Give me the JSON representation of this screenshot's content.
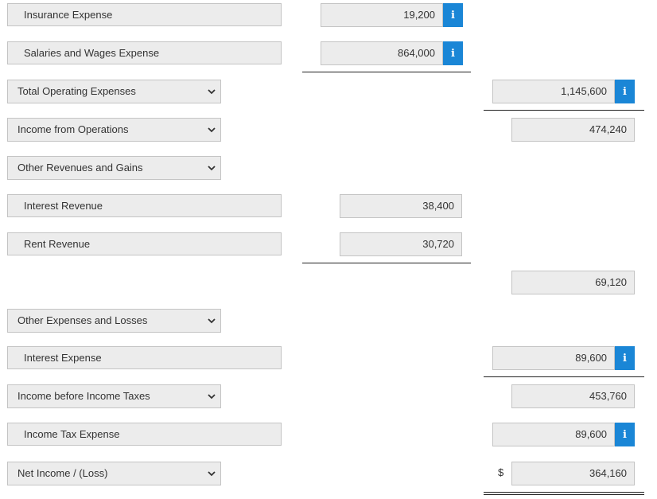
{
  "rows": {
    "insurance_expense": {
      "label": "Insurance Expense",
      "value": "19,200"
    },
    "salaries_wages_expense": {
      "label": "Salaries and Wages Expense",
      "value": "864,000"
    },
    "total_operating_expenses": {
      "label": "Total Operating Expenses",
      "value": "1,145,600"
    },
    "income_from_operations": {
      "label": "Income from Operations",
      "value": "474,240"
    },
    "other_revenues_gains": {
      "label": "Other Revenues and Gains"
    },
    "interest_revenue": {
      "label": "Interest Revenue",
      "value": "38,400"
    },
    "rent_revenue": {
      "label": "Rent Revenue",
      "value": "30,720"
    },
    "other_revenues_total": {
      "value": "69,120"
    },
    "other_expenses_losses": {
      "label": "Other Expenses and Losses"
    },
    "interest_expense": {
      "label": "Interest Expense",
      "value": "89,600"
    },
    "income_before_taxes": {
      "label": "Income before Income Taxes",
      "value": "453,760"
    },
    "income_tax_expense": {
      "label": "Income Tax Expense",
      "value": "89,600"
    },
    "net_income": {
      "label": "Net Income / (Loss)",
      "value": "364,160",
      "currency": "$"
    }
  },
  "icons": {
    "info": "i",
    "chevron": "chevron-down-icon"
  },
  "colors": {
    "info_button": "#1a86d6",
    "field_bg": "#ececec",
    "field_border": "#c4c4c4"
  }
}
